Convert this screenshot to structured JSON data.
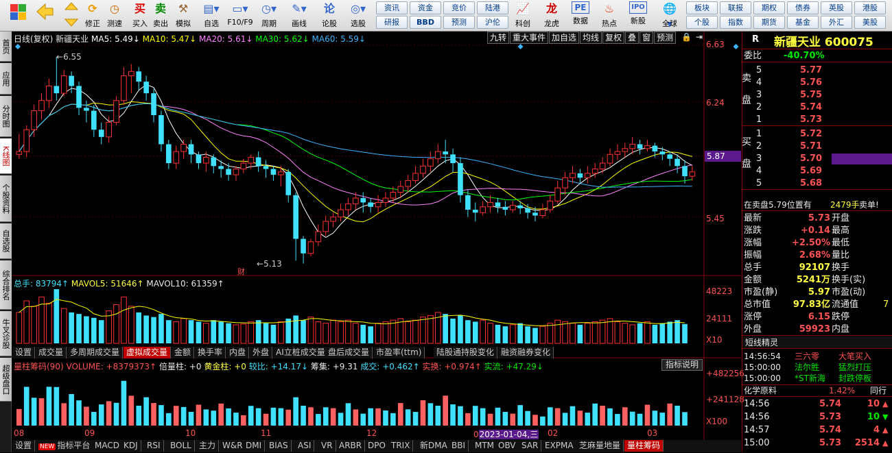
{
  "toolbar": {
    "buttons": [
      {
        "name": "start-menu",
        "label": "",
        "icon": "grid-icon"
      },
      {
        "name": "back",
        "label": "",
        "icon": "back-arrow-icon"
      },
      {
        "name": "up",
        "label": "修正",
        "icon": "up-down-icon"
      },
      {
        "name": "refresh",
        "label": "测速",
        "icon": "speedtest-icon"
      },
      {
        "name": "buy",
        "label": "买入",
        "icon": "买"
      },
      {
        "name": "sell",
        "label": "卖出",
        "icon": "卖"
      },
      {
        "name": "simulate",
        "label": "模拟",
        "icon": "hammer-icon"
      },
      {
        "name": "watchlist",
        "label": "自选",
        "icon": "folder-icon"
      },
      {
        "name": "f10",
        "label": "F10/F9",
        "icon": "window-icon"
      },
      {
        "name": "period",
        "label": "周期",
        "icon": "clock-icon"
      },
      {
        "name": "draw",
        "label": "画线",
        "icon": "pencil-icon"
      },
      {
        "name": "stock-talk",
        "label": "论股",
        "icon": "论"
      },
      {
        "name": "stock-pick",
        "label": "选股",
        "icon": "select-icon"
      },
      {
        "name": "scan",
        "label": "科创",
        "icon": "chart-icon"
      },
      {
        "name": "dragon-tiger",
        "label": "龙虎",
        "icon": "龙"
      },
      {
        "name": "data",
        "label": "数据",
        "icon": "PE"
      },
      {
        "name": "hot",
        "label": "热点",
        "icon": "hot-icon"
      },
      {
        "name": "ipo",
        "label": "新股",
        "icon": "IPO"
      },
      {
        "name": "global",
        "label": "全球",
        "icon": "globe-icon"
      }
    ],
    "quick_grid": [
      [
        "资讯",
        "资金",
        "竞价",
        "陆港"
      ],
      [
        "研报",
        "BBD",
        "预测",
        "沪伦"
      ]
    ],
    "quick_grid2": [
      [
        "板块",
        "期权",
        "债券",
        "英股",
        "港股"
      ],
      [
        "个股",
        "指数",
        "基金",
        "外汇",
        "美股"
      ]
    ],
    "quick_grid2_row0_col1": "联报"
  },
  "sidebar": [
    "首页",
    "应用",
    "分时图",
    "K线图",
    "个股资料",
    "自选股",
    "综合排名",
    "牛叉诊股",
    "超级盘口"
  ],
  "chart": {
    "header": "日线(复权)  新疆天业",
    "ma": [
      {
        "label": "MA5: 5.49",
        "color": "#ffffff"
      },
      {
        "label": "MA10: 5.47",
        "color": "#ffff00"
      },
      {
        "label": "MA20: 5.61",
        "color": "#ff80ff"
      },
      {
        "label": "MA30: 5.62",
        "color": "#00ff00"
      },
      {
        "label": "MA60: 5.59",
        "color": "#3cb4ff"
      }
    ],
    "top_buttons": [
      "九转",
      "重大事件",
      "加自选",
      "均线",
      "复权",
      "叠",
      "窗",
      "预测"
    ],
    "y_labels": [
      "6.63",
      "6.24",
      "5.87",
      "5.45"
    ],
    "current_price_tag": "5.87",
    "annot_high": "6.55",
    "annot_low": "5.13",
    "annot_cai": "财",
    "vol_header": {
      "main": "总手: 83794↑",
      "mav5": "MAVOL5: 51646↑",
      "mav10": "MAVOL10: 61359↑"
    },
    "vol_y": [
      "48223",
      "24111",
      "X10"
    ],
    "tabs": [
      "设置",
      "成交量",
      "多周期成交量",
      "虚拟成交量",
      "金额",
      "换手率",
      "内盘",
      "外盘",
      "AI立桩成交量",
      "盘后成交量",
      "市盈率(ttm)",
      "陆股通持股变化",
      "融资融券变化"
    ],
    "active_tab": "虚拟成交量",
    "ind_header": {
      "title": "量柱筹码(90) VOLUME: +8379373↑",
      "p1": "倍量柱: +0",
      "p2": "黄金柱: +0",
      "p3": "较比: +14.17↓",
      "p4": "筹集: +9.31",
      "p5": "成交: +0.462↑",
      "p6": "实换: +0.974↑",
      "p7": "实流: +47.29↓"
    },
    "ind_button": "指标说明",
    "ind_y": [
      "+482256",
      "+241128",
      "X100"
    ],
    "x_labels": [
      "08",
      "09",
      "10",
      "11",
      "12",
      "02",
      "03"
    ],
    "x_highlight": "2023-01-04,三",
    "x_highlight_prefix": "0",
    "bottom_tabs": [
      "设置",
      "指标平台",
      "MACD",
      "KDJ",
      "RSI",
      "BOLL",
      "主力",
      "W&R",
      "DMI",
      "BIAS",
      "ASI",
      "VR",
      "ARBR",
      "DPO",
      "TRIX",
      "新DMA",
      "BBI",
      "MTM",
      "OBV",
      "SAR",
      "EXPMA",
      "芝麻量地量",
      "量柱筹码"
    ],
    "new_badge": "NEW",
    "candles": [
      [
        5.88,
        5.9,
        5.85,
        6.02
      ],
      [
        5.9,
        6.05,
        5.86,
        6.08
      ],
      [
        6.05,
        6.18,
        6.0,
        6.22
      ],
      [
        6.18,
        6.25,
        6.12,
        6.3
      ],
      [
        6.25,
        6.35,
        6.2,
        6.4
      ],
      [
        6.35,
        6.3,
        6.25,
        6.55
      ],
      [
        6.3,
        6.42,
        6.28,
        6.46
      ],
      [
        6.42,
        6.35,
        6.3,
        6.45
      ],
      [
        6.35,
        6.2,
        6.15,
        6.38
      ],
      [
        6.2,
        6.18,
        6.1,
        6.25
      ],
      [
        6.18,
        6.05,
        6.0,
        6.22
      ],
      [
        6.05,
        6.0,
        5.95,
        6.1
      ],
      [
        6.0,
        6.1,
        5.96,
        6.14
      ],
      [
        6.1,
        6.25,
        6.08,
        6.28
      ],
      [
        6.25,
        6.42,
        6.22,
        6.48
      ],
      [
        6.42,
        6.45,
        6.3,
        6.5
      ],
      [
        6.45,
        6.38,
        6.32,
        6.48
      ],
      [
        6.38,
        6.3,
        6.25,
        6.42
      ],
      [
        6.3,
        6.15,
        6.1,
        6.33
      ],
      [
        6.15,
        5.95,
        5.9,
        6.18
      ],
      [
        5.95,
        5.82,
        5.78,
        5.98
      ],
      [
        5.82,
        5.9,
        5.78,
        5.94
      ],
      [
        5.9,
        5.95,
        5.85,
        5.98
      ],
      [
        5.95,
        5.88,
        5.82,
        5.98
      ],
      [
        5.88,
        5.82,
        5.78,
        5.9
      ],
      [
        5.82,
        5.86,
        5.76,
        5.9
      ],
      [
        5.86,
        5.8,
        5.75,
        5.88
      ],
      [
        5.8,
        5.78,
        5.72,
        5.84
      ],
      [
        5.78,
        5.74,
        5.7,
        5.82
      ],
      [
        5.74,
        5.78,
        5.7,
        5.8
      ],
      [
        5.78,
        5.82,
        5.75,
        5.85
      ],
      [
        5.82,
        5.86,
        5.78,
        5.88
      ],
      [
        5.86,
        5.8,
        5.76,
        5.9
      ],
      [
        5.8,
        5.78,
        5.72,
        5.84
      ],
      [
        5.78,
        5.74,
        5.7,
        5.8
      ],
      [
        5.74,
        5.76,
        5.66,
        5.8
      ],
      [
        5.76,
        5.6,
        5.55,
        5.78
      ],
      [
        5.6,
        5.3,
        5.15,
        5.62
      ],
      [
        5.3,
        5.2,
        5.13,
        5.32
      ],
      [
        5.2,
        5.28,
        5.18,
        5.3
      ],
      [
        5.28,
        5.35,
        5.25,
        5.4
      ],
      [
        5.35,
        5.42,
        5.32,
        5.46
      ],
      [
        5.42,
        5.45,
        5.38,
        5.48
      ],
      [
        5.45,
        5.5,
        5.42,
        5.54
      ],
      [
        5.5,
        5.54,
        5.46,
        5.58
      ],
      [
        5.54,
        5.58,
        5.5,
        5.62
      ],
      [
        5.58,
        5.55,
        5.48,
        5.62
      ],
      [
        5.55,
        5.52,
        5.48,
        5.58
      ],
      [
        5.52,
        5.55,
        5.48,
        5.6
      ],
      [
        5.55,
        5.58,
        5.52,
        5.62
      ],
      [
        5.58,
        5.62,
        5.55,
        5.66
      ],
      [
        5.62,
        5.66,
        5.58,
        5.7
      ],
      [
        5.66,
        5.7,
        5.62,
        5.74
      ],
      [
        5.7,
        5.75,
        5.68,
        5.8
      ],
      [
        5.75,
        5.8,
        5.72,
        5.85
      ],
      [
        5.8,
        5.85,
        5.76,
        5.9
      ],
      [
        5.85,
        5.9,
        5.82,
        5.95
      ],
      [
        5.9,
        5.88,
        5.82,
        5.98
      ],
      [
        5.88,
        5.82,
        5.76,
        5.92
      ],
      [
        5.82,
        5.6,
        5.55,
        5.86
      ],
      [
        5.6,
        5.5,
        5.45,
        5.64
      ],
      [
        5.5,
        5.48,
        5.42,
        5.55
      ],
      [
        5.48,
        5.52,
        5.46,
        5.56
      ],
      [
        5.52,
        5.55,
        5.48,
        5.6
      ],
      [
        5.55,
        5.52,
        5.48,
        5.58
      ],
      [
        5.52,
        5.5,
        5.46,
        5.56
      ],
      [
        5.5,
        5.53,
        5.48,
        5.56
      ],
      [
        5.53,
        5.51,
        5.47,
        5.56
      ],
      [
        5.51,
        5.48,
        5.44,
        5.54
      ],
      [
        5.48,
        5.46,
        5.42,
        5.52
      ],
      [
        5.46,
        5.5,
        5.44,
        5.54
      ],
      [
        5.5,
        5.56,
        5.48,
        5.6
      ],
      [
        5.56,
        5.65,
        5.54,
        5.7
      ],
      [
        5.65,
        5.72,
        5.6,
        5.76
      ],
      [
        5.72,
        5.75,
        5.68,
        5.8
      ],
      [
        5.75,
        5.72,
        5.68,
        5.78
      ],
      [
        5.72,
        5.75,
        5.68,
        5.8
      ],
      [
        5.75,
        5.78,
        5.72,
        5.82
      ],
      [
        5.78,
        5.82,
        5.75,
        5.86
      ],
      [
        5.82,
        5.88,
        5.8,
        5.92
      ],
      [
        5.88,
        5.9,
        5.84,
        5.95
      ],
      [
        5.9,
        5.92,
        5.86,
        5.96
      ],
      [
        5.92,
        5.95,
        5.88,
        6.0
      ],
      [
        5.95,
        5.92,
        5.88,
        5.98
      ],
      [
        5.92,
        5.94,
        5.9,
        5.98
      ],
      [
        5.94,
        5.9,
        5.86,
        5.96
      ],
      [
        5.9,
        5.88,
        5.84,
        5.93
      ],
      [
        5.88,
        5.85,
        5.8,
        5.9
      ],
      [
        5.85,
        5.8,
        5.75,
        5.88
      ],
      [
        5.8,
        5.73,
        5.68,
        5.84
      ],
      [
        5.73,
        5.76,
        5.7,
        5.8
      ]
    ],
    "vol": [
      40,
      55,
      48,
      60,
      52,
      70,
      45,
      40,
      38,
      35,
      33,
      30,
      42,
      50,
      60,
      48,
      40,
      36,
      34,
      38,
      30,
      28,
      32,
      30,
      28,
      26,
      30,
      28,
      26,
      24,
      25,
      28,
      30,
      26,
      24,
      28,
      32,
      36,
      30,
      34,
      28,
      26,
      30,
      28,
      30,
      26,
      24,
      22,
      26,
      28,
      30,
      32,
      28,
      30,
      34,
      36,
      40,
      38,
      32,
      36,
      30,
      28,
      30,
      26,
      24,
      22,
      24,
      26,
      22,
      20,
      22,
      26,
      30,
      28,
      26,
      24,
      26,
      28,
      30,
      32,
      28,
      26,
      24,
      26,
      28,
      24,
      26,
      28,
      30,
      25
    ]
  },
  "right": {
    "code": "R",
    "name": "新疆天业 600075",
    "weibi": {
      "label": "委比",
      "value": "-40.70%"
    },
    "sell": [
      [
        "5",
        "5.77"
      ],
      [
        "4",
        "5.76"
      ],
      [
        "3",
        "5.75"
      ],
      [
        "2",
        "5.74"
      ],
      [
        "1",
        "5.73"
      ]
    ],
    "sell_label": "卖盘",
    "buy": [
      [
        "1",
        "5.72"
      ],
      [
        "2",
        "5.71"
      ],
      [
        "3",
        "5.70"
      ],
      [
        "4",
        "5.69"
      ],
      [
        "5",
        "5.68"
      ]
    ],
    "buy_label": "买盘",
    "notice": {
      "text": "在卖盘5.79位置有",
      "vol": "2479手",
      "tag": "卖单!"
    },
    "stats": [
      [
        "最新",
        "5.73",
        "开盘",
        ""
      ],
      [
        "涨跌",
        "+0.14",
        "最高",
        ""
      ],
      [
        "涨幅",
        "+2.50%",
        "最低",
        ""
      ],
      [
        "振幅",
        "2.68%",
        "量比",
        ""
      ],
      [
        "总手",
        "92107",
        "换手",
        ""
      ],
      [
        "金额",
        "5241万",
        "换手(实)",
        ""
      ],
      [
        "市盈(静)",
        "5.97",
        "市盈(动)",
        ""
      ],
      [
        "总市值",
        "97.83亿",
        "流通值",
        "7"
      ],
      [
        "涨停",
        "6.15",
        "跌停",
        ""
      ],
      [
        "外盘",
        "59923",
        "内盘",
        ""
      ]
    ],
    "short_title": "短线精灵",
    "short": [
      [
        "14:56:54",
        "三六零",
        "大笔买入"
      ],
      [
        "15:00:00",
        "法尔胜",
        "猛烈打压"
      ],
      [
        "15:00:00",
        "*ST新海",
        "封跌停板"
      ]
    ],
    "sector": {
      "name": "化学原料",
      "pct": "1.42%",
      "tag": "同行"
    },
    "ticks": [
      [
        "14:56",
        "5.74",
        "10",
        "up"
      ],
      [
        "14:56",
        "5.73",
        "10",
        "down"
      ],
      [
        "14:57",
        "5.74",
        "4",
        "up"
      ],
      [
        "15:00",
        "5.73",
        "2514",
        "up"
      ]
    ]
  }
}
